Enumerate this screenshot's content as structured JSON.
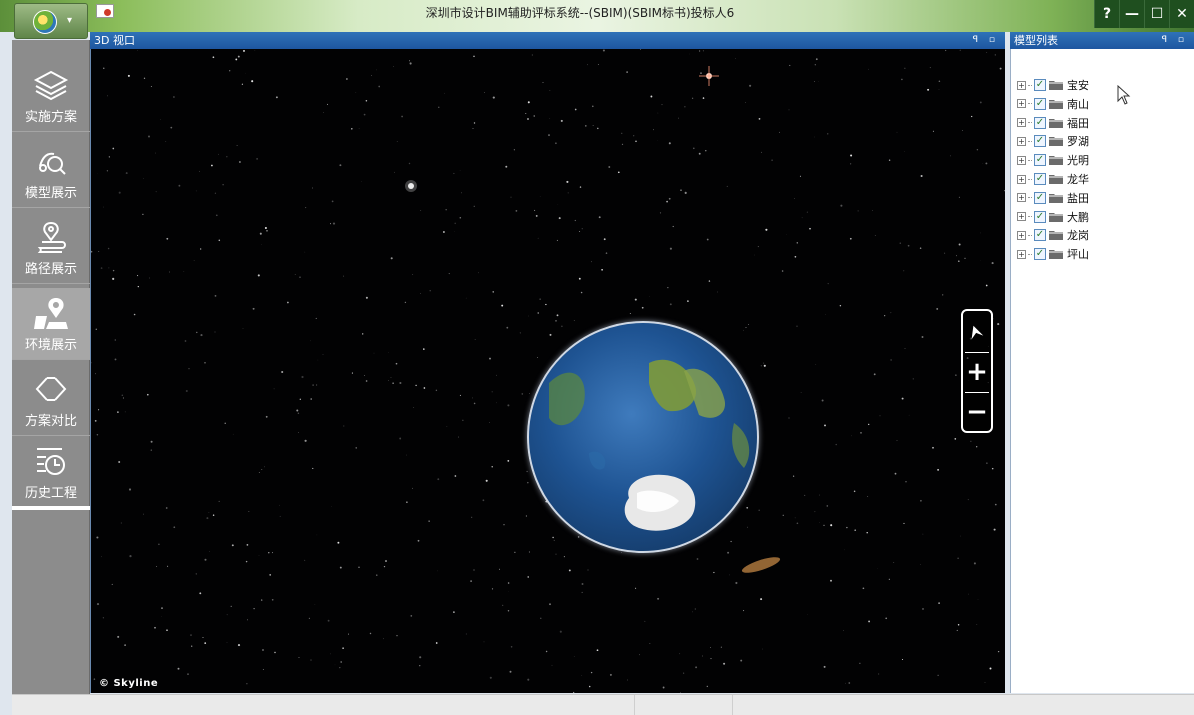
{
  "window": {
    "title": "深圳市设计BIM辅助评标系统--(SBIM)(SBIM标书)投标人6",
    "controls": {
      "help": "?",
      "minimize": "—",
      "maximize": "☐",
      "close": "✕"
    }
  },
  "app_menu": {
    "arrow": "▾"
  },
  "viewport": {
    "header": "3D 视口",
    "pin_icons": "ꟼ ▫",
    "credit": "© Skyline",
    "nav": {
      "zoom_in": "+",
      "zoom_out": "−"
    }
  },
  "sidebar": {
    "items": [
      {
        "label": "实施方案",
        "icon": "layers-icon"
      },
      {
        "label": "模型展示",
        "icon": "model-search-icon"
      },
      {
        "label": "路径展示",
        "icon": "route-pin-icon"
      },
      {
        "label": "环境展示",
        "icon": "map-pin-icon",
        "active": true
      },
      {
        "label": "方案对比",
        "icon": "compare-diamond-icon"
      },
      {
        "label": "历史工程",
        "icon": "history-clock-icon"
      }
    ]
  },
  "model_list": {
    "header": "模型列表",
    "pin_icons": "ꟼ ▫",
    "items": [
      {
        "label": "宝安",
        "checked": true
      },
      {
        "label": "南山",
        "checked": true
      },
      {
        "label": "福田",
        "checked": true
      },
      {
        "label": "罗湖",
        "checked": true
      },
      {
        "label": "光明",
        "checked": true
      },
      {
        "label": "龙华",
        "checked": true
      },
      {
        "label": "盐田",
        "checked": true
      },
      {
        "label": "大鹏",
        "checked": true
      },
      {
        "label": "龙岗",
        "checked": true
      },
      {
        "label": "坪山",
        "checked": true
      }
    ],
    "expander": "+",
    "check_mark": "✓"
  },
  "colors": {
    "accent": "#1e56a0",
    "sidebar": "#8c8c8c",
    "sidebar_active": "#a7a7a7",
    "title_dark": "#1f4f1f"
  }
}
